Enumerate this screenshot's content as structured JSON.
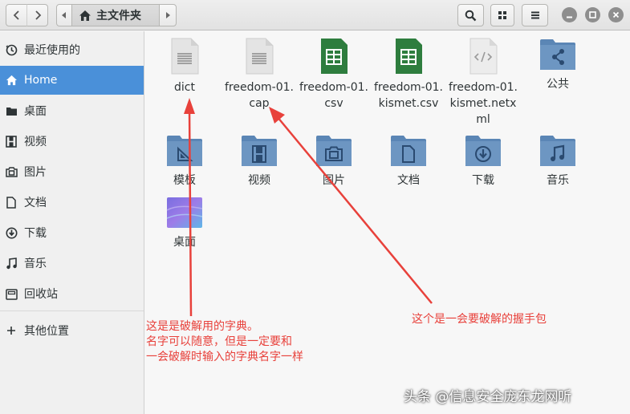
{
  "header": {
    "path_label": "主文件夹",
    "icons": [
      "chevron-left-icon",
      "chevron-right-icon",
      "home-icon",
      "search-icon",
      "grid-view-icon",
      "hamburger-menu-icon",
      "minimize-icon",
      "maximize-icon",
      "close-icon"
    ]
  },
  "sidebar": {
    "items": [
      {
        "label": "最近使用的",
        "icon": "clock-icon"
      },
      {
        "label": "Home",
        "icon": "home-icon",
        "active": true
      },
      {
        "label": "桌面",
        "icon": "folder-icon"
      },
      {
        "label": "视频",
        "icon": "film-icon"
      },
      {
        "label": "图片",
        "icon": "camera-icon"
      },
      {
        "label": "文档",
        "icon": "document-icon"
      },
      {
        "label": "下载",
        "icon": "download-icon"
      },
      {
        "label": "音乐",
        "icon": "music-icon"
      },
      {
        "label": "回收站",
        "icon": "trash-icon"
      },
      {
        "label": "其他位置",
        "icon": "plus-icon"
      }
    ]
  },
  "files": [
    {
      "name": "dict",
      "type": "text"
    },
    {
      "name": "freedom-01.cap",
      "type": "text"
    },
    {
      "name": "freedom-01.csv",
      "type": "spreadsheet"
    },
    {
      "name": "freedom-01.kismet.csv",
      "type": "spreadsheet"
    },
    {
      "name": "freedom-01.kismet.netxml",
      "type": "code"
    },
    {
      "name": "公共",
      "type": "folder-share"
    },
    {
      "name": "模板",
      "type": "folder-templates"
    },
    {
      "name": "视频",
      "type": "folder-videos"
    },
    {
      "name": "图片",
      "type": "folder-pictures"
    },
    {
      "name": "文档",
      "type": "folder-documents"
    },
    {
      "name": "下载",
      "type": "folder-downloads"
    },
    {
      "name": "音乐",
      "type": "folder-music"
    },
    {
      "name": "桌面",
      "type": "folder-desktop"
    }
  ],
  "annotations": {
    "left_lines": [
      "这是是破解用的字典。",
      "名字可以随意，但是一定要和",
      "一会破解时输入的字典名字一样"
    ],
    "right_text": "这个是一会要破解的握手包"
  },
  "watermark": "头条 @信息安全庞东龙网听",
  "colors": {
    "accent": "#4a90d9",
    "folder": "#6d96c2",
    "annotation": "#e8413b",
    "sheet": "#2e7d3e"
  }
}
